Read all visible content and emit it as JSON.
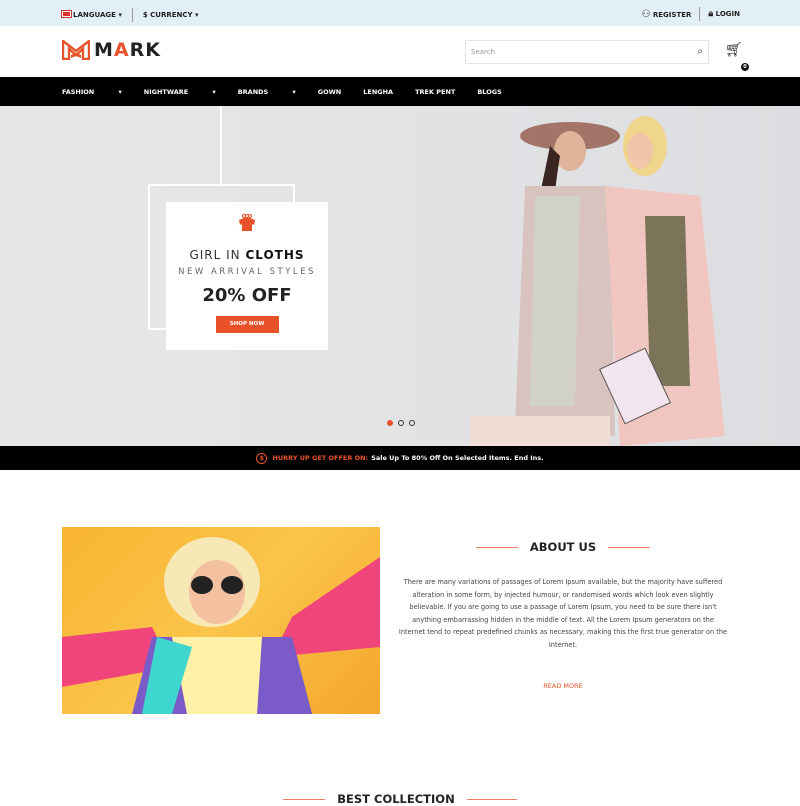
{
  "topbar": {
    "language": "LANGUAGE",
    "currency": "$ CURRENCY",
    "register": "REGISTER",
    "login": "LOGIN"
  },
  "header": {
    "logo_prefix": "M",
    "logo_accent": "A",
    "logo_suffix": "RK",
    "search_placeholder": "Search",
    "cart_count": "0"
  },
  "nav": [
    "FASHION",
    "NIGHTWARE",
    "BRANDS",
    "GOWN",
    "LENGHA",
    "TREK PENT",
    "BLOGS"
  ],
  "nav_dropdown": [
    true,
    true,
    true,
    false,
    false,
    false,
    false
  ],
  "hero": {
    "title_light": "GIRL IN ",
    "title_bold": "CLOTHS",
    "subtitle": "NEW ARRIVAL STYLES",
    "offer": "20% OFF",
    "button": "SHOP NOW",
    "active_slide": 1,
    "slides": 3
  },
  "offer_bar": {
    "highlight": "HURRY UP GET OFFER ON:",
    "text": "Sale Up To 80% Off On Selected Items. End Ins."
  },
  "about": {
    "title": "ABOUT US",
    "body": "There are many variations of passages of Lorem Ipsum available, but the majority have suffered alteration in some form, by injected humour, or randomised words which look even slightly believable. If you are going to use a passage of Lorem Ipsum, you need to be sure there isn't anything embarrassing hidden in the middle of text. All the Lorem Ipsum generators on the Internet tend to repeat predefined chunks as necessary, making this the first true generator on the Internet.",
    "read_more": "READ MORE"
  },
  "best": {
    "title": "BEST COLLECTION"
  },
  "colors": {
    "accent": "#e8522a",
    "topbar": "#e3eff7",
    "nav": "#000000"
  }
}
